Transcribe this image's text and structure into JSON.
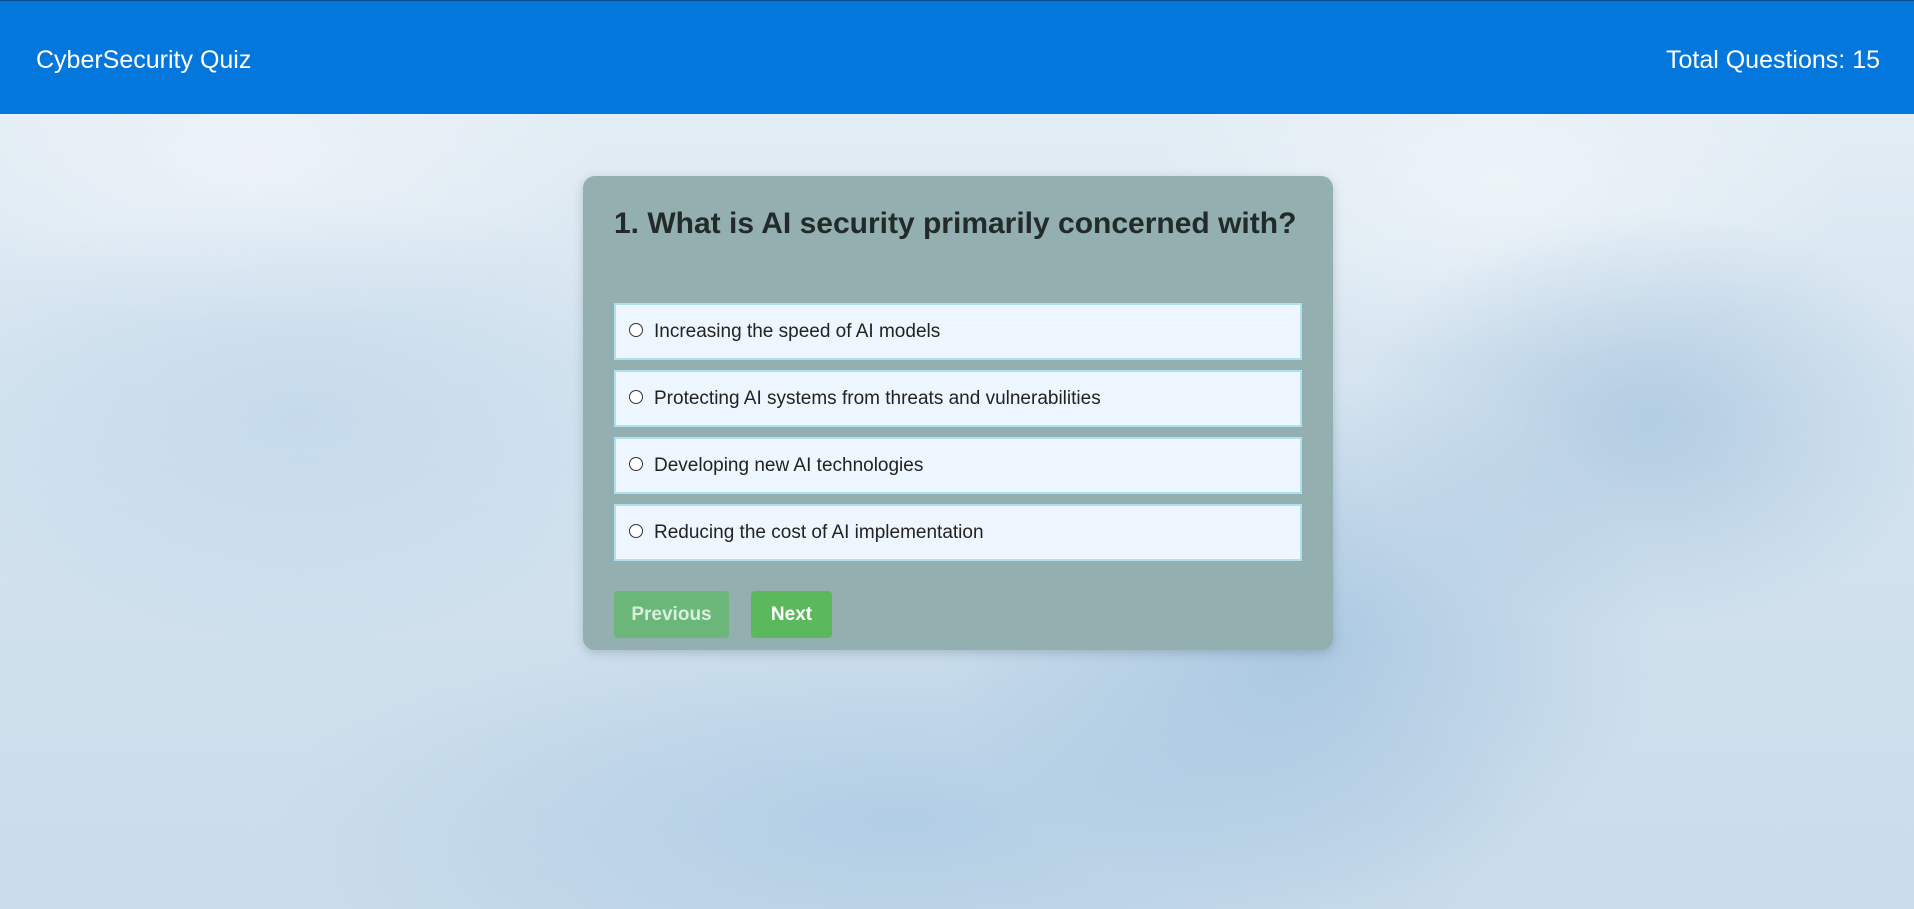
{
  "header": {
    "title": "CyberSecurity Quiz",
    "total_questions": "Total Questions: 15"
  },
  "quiz": {
    "question": "1. What is AI security primarily concerned with?",
    "options": [
      "Increasing the speed of AI models",
      "Protecting AI systems from threats and vulnerabilities",
      "Developing new AI technologies",
      "Reducing the cost of AI implementation"
    ],
    "selected": null,
    "buttons": {
      "previous": "Previous",
      "next": "Next",
      "previous_disabled": true
    }
  },
  "colors": {
    "header_bg": "#0477dc",
    "card_bg": "#93afaf",
    "option_bg": "#eef7ff",
    "option_border": "#aee0f2",
    "button_green": "#5cb85c"
  }
}
